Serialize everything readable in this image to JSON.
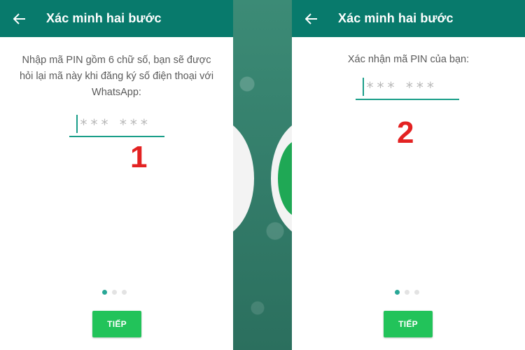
{
  "screens": [
    {
      "title": "Xác minh hai bước",
      "instruction": "Nhập mã PIN gồm 6 chữ số, bạn sẽ được hỏi lại mã này khi đăng ký số điện thoại với WhatsApp:",
      "pin_placeholder": "*** ***",
      "step_number": "1",
      "active_page": 1,
      "page_count": 3,
      "button_label": "TIẾP",
      "back_icon": "arrow-left-icon"
    },
    {
      "title": "Xác minh hai bước",
      "instruction": "Xác nhận mã PIN của bạn:",
      "pin_placeholder": "*** ***",
      "step_number": "2",
      "active_page": 1,
      "page_count": 3,
      "button_label": "TIẾP",
      "back_icon": "arrow-left-icon"
    }
  ],
  "colors": {
    "app_bar": "#087a6c",
    "accent": "#1a9e89",
    "button": "#22c35a",
    "step_number": "#e32222"
  }
}
